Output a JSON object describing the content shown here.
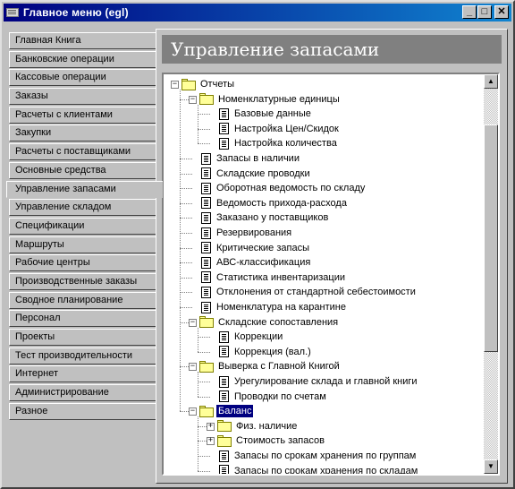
{
  "window": {
    "title": "Главное меню (egl)",
    "minimize_glyph": "_",
    "maximize_glyph": "□",
    "close_glyph": "✕"
  },
  "nav": {
    "items": [
      {
        "label": "Главная Книга"
      },
      {
        "label": "Банковские операции"
      },
      {
        "label": "Кассовые операции"
      },
      {
        "label": "Заказы"
      },
      {
        "label": "Расчеты с клиентами"
      },
      {
        "label": "Закупки"
      },
      {
        "label": "Расчеты с поставщиками"
      },
      {
        "label": "Основные средства"
      },
      {
        "label": "Управление запасами",
        "active": true
      },
      {
        "label": "Управление складом"
      },
      {
        "label": "Спецификации"
      },
      {
        "label": "Маршруты"
      },
      {
        "label": "Рабочие центры"
      },
      {
        "label": "Производственные заказы"
      },
      {
        "label": "Сводное планирование"
      },
      {
        "label": "Персонал"
      },
      {
        "label": "Проекты"
      },
      {
        "label": "Тест производительности"
      },
      {
        "label": "Интернет"
      },
      {
        "label": "Администрирование"
      },
      {
        "label": "Разное"
      }
    ]
  },
  "content": {
    "title": "Управление запасами"
  },
  "tree": {
    "rows": [
      {
        "label": "Отчеты",
        "level": 0,
        "type": "folder",
        "expander": "−"
      },
      {
        "label": "Номенклатурные единицы",
        "level": 1,
        "type": "folder",
        "expander": "−"
      },
      {
        "label": "Базовые данные",
        "level": 2,
        "type": "doc"
      },
      {
        "label": "Настройка Цен/Скидок",
        "level": 2,
        "type": "doc"
      },
      {
        "label": "Настройка количества",
        "level": 2,
        "type": "doc"
      },
      {
        "label": "Запасы в наличии",
        "level": 1,
        "type": "doc"
      },
      {
        "label": "Складские проводки",
        "level": 1,
        "type": "doc"
      },
      {
        "label": "Оборотная ведомость по складу",
        "level": 1,
        "type": "doc"
      },
      {
        "label": "Ведомость прихода-расхода",
        "level": 1,
        "type": "doc"
      },
      {
        "label": "Заказано у поставщиков",
        "level": 1,
        "type": "doc"
      },
      {
        "label": "Резервирования",
        "level": 1,
        "type": "doc"
      },
      {
        "label": "Критические запасы",
        "level": 1,
        "type": "doc"
      },
      {
        "label": "АВС-классификация",
        "level": 1,
        "type": "doc"
      },
      {
        "label": "Статистика инвентаризации",
        "level": 1,
        "type": "doc"
      },
      {
        "label": "Отклонения от стандартной себестоимости",
        "level": 1,
        "type": "doc"
      },
      {
        "label": "Номенклатура на карантине",
        "level": 1,
        "type": "doc"
      },
      {
        "label": "Складские сопоставления",
        "level": 1,
        "type": "folder",
        "expander": "−"
      },
      {
        "label": "Коррекции",
        "level": 2,
        "type": "doc"
      },
      {
        "label": "Коррекция (вал.)",
        "level": 2,
        "type": "doc"
      },
      {
        "label": "Выверка с Главной Книгой",
        "level": 1,
        "type": "folder",
        "expander": "−"
      },
      {
        "label": "Урегулирование склада и главной книги",
        "level": 2,
        "type": "doc"
      },
      {
        "label": "Проводки по счетам",
        "level": 2,
        "type": "doc"
      },
      {
        "label": "Баланс",
        "level": 1,
        "type": "folder",
        "expander": "−",
        "selected": true
      },
      {
        "label": "Физ. наличие",
        "level": 2,
        "type": "folder",
        "expander": "+"
      },
      {
        "label": "Стоимость запасов",
        "level": 2,
        "type": "folder",
        "expander": "+"
      },
      {
        "label": "Запасы по срокам хранения по группам",
        "level": 2,
        "type": "doc"
      },
      {
        "label": "Запасы по срокам хранения по складам",
        "level": 2,
        "type": "doc"
      }
    ]
  },
  "scrollbar": {
    "up_glyph": "▲",
    "down_glyph": "▼"
  }
}
